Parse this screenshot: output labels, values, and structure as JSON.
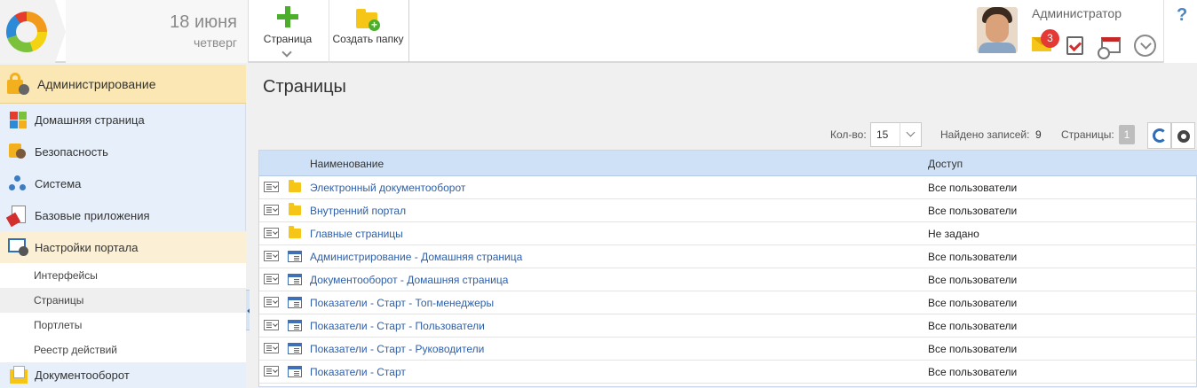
{
  "header": {
    "date": "18 июня",
    "weekday": "четверг",
    "toolbar": {
      "page_label": "Страница",
      "create_folder_label": "Создать папку"
    },
    "user": {
      "name": "Администратор",
      "notifications": "3"
    },
    "help": "?"
  },
  "sidebar": {
    "items": [
      {
        "label": "Администрирование",
        "icon": "admin-icon"
      },
      {
        "label": "Домашняя страница",
        "icon": "home-tiles-icon"
      },
      {
        "label": "Безопасность",
        "icon": "security-icon"
      },
      {
        "label": "Система",
        "icon": "system-icon"
      },
      {
        "label": "Базовые приложения",
        "icon": "apps-icon"
      },
      {
        "label": "Настройки портала",
        "icon": "portal-settings-icon"
      }
    ],
    "subitems": [
      {
        "label": "Интерфейсы"
      },
      {
        "label": "Страницы"
      },
      {
        "label": "Портлеты"
      },
      {
        "label": "Реестр действий"
      }
    ],
    "bottom_item": {
      "label": "Документооборот",
      "icon": "documents-icon"
    }
  },
  "main": {
    "title": "Страницы",
    "pager": {
      "count_label": "Кол-во:",
      "count_value": "15",
      "found_label": "Найдено записей:",
      "found_value": "9",
      "pages_label": "Страницы:",
      "current_page": "1"
    },
    "table": {
      "columns": [
        "Наименование",
        "Доступ"
      ],
      "rows": [
        {
          "type": "folder",
          "name": "Электронный документооборот",
          "access": "Все пользователи"
        },
        {
          "type": "folder",
          "name": "Внутренний портал",
          "access": "Все пользователи"
        },
        {
          "type": "folder",
          "name": "Главные страницы",
          "access": "Не задано"
        },
        {
          "type": "page",
          "name": "Администрирование - Домашняя страница",
          "access": "Все пользователи"
        },
        {
          "type": "page",
          "name": "Документооборот - Домашняя страница",
          "access": "Все пользователи"
        },
        {
          "type": "page",
          "name": "Показатели - Старт - Топ-менеджеры",
          "access": "Все пользователи"
        },
        {
          "type": "page",
          "name": "Показатели - Старт - Пользователи",
          "access": "Все пользователи"
        },
        {
          "type": "page",
          "name": "Показатели - Старт - Руководители",
          "access": "Все пользователи"
        },
        {
          "type": "page",
          "name": "Показатели - Старт",
          "access": "Все пользователи"
        }
      ]
    }
  },
  "colors": {
    "accent": "#2e5fa8",
    "sidebar_bg": "#e7f0fa",
    "active_item": "#fbe7b4",
    "badge": "#e53935"
  }
}
